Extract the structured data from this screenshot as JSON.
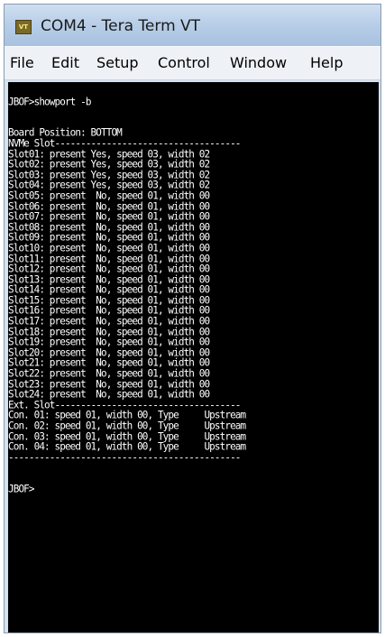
{
  "window": {
    "icon_text": "VT",
    "title": "COM4 - Tera Term VT"
  },
  "menu": {
    "items": [
      "File",
      "Edit",
      "Setup",
      "Control",
      "Window",
      "Help"
    ]
  },
  "terminal": {
    "lines": [
      "",
      "JBOF>showport -b",
      "",
      "",
      "Board Position: BOTTOM",
      "NVMe Slot------------------------------------",
      "Slot01: present Yes, speed 03, width 02",
      "Slot02: present Yes, speed 03, width 02",
      "Slot03: present Yes, speed 03, width 02",
      "Slot04: present Yes, speed 03, width 02",
      "Slot05: present  No, speed 01, width 00",
      "Slot06: present  No, speed 01, width 00",
      "Slot07: present  No, speed 01, width 00",
      "Slot08: present  No, speed 01, width 00",
      "Slot09: present  No, speed 01, width 00",
      "Slot10: present  No, speed 01, width 00",
      "Slot11: present  No, speed 01, width 00",
      "Slot12: present  No, speed 01, width 00",
      "Slot13: present  No, speed 01, width 00",
      "Slot14: present  No, speed 01, width 00",
      "Slot15: present  No, speed 01, width 00",
      "Slot16: present  No, speed 01, width 00",
      "Slot17: present  No, speed 01, width 00",
      "Slot18: present  No, speed 01, width 00",
      "Slot19: present  No, speed 01, width 00",
      "Slot20: present  No, speed 01, width 00",
      "Slot21: present  No, speed 01, width 00",
      "Slot22: present  No, speed 01, width 00",
      "Slot23: present  No, speed 01, width 00",
      "Slot24: present  No, speed 01, width 00",
      "Ext. Slot------------------------------------",
      "Con. 01: speed 01, width 00, Type     Upstream",
      "Con. 02: speed 01, width 00, Type     Upstream",
      "Con. 03: speed 01, width 00, Type     Upstream",
      "Con. 04: speed 01, width 00, Type     Upstream",
      "---------------------------------------------",
      "",
      "",
      "JBOF>"
    ]
  },
  "colors": {
    "terminal_bg": "#000000",
    "terminal_fg": "#ffffff",
    "titlebar": "#b9cfe8"
  }
}
